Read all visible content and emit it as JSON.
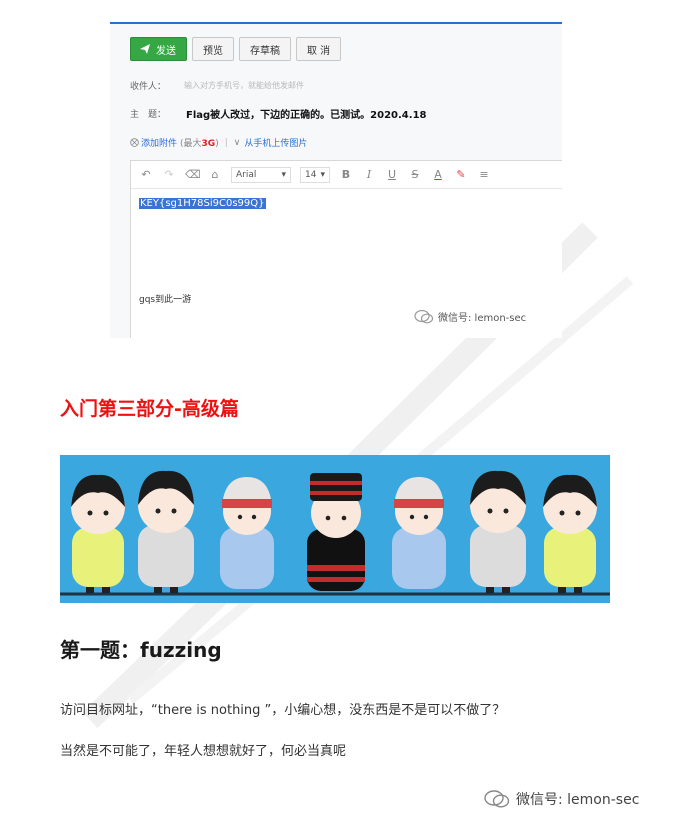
{
  "email": {
    "toolbar": {
      "send": "发送",
      "preview": "预览",
      "draft": "存草稿",
      "cancel": "取 消"
    },
    "recipient_label": "收件人：",
    "recipient_placeholder": "输入对方手机号，就能给他发邮件",
    "subject_label": "主　题：",
    "subject_value": "Flag被人改过，下边的正确的。已测试。2020.4.18",
    "attachment_link": "添加附件",
    "attachment_limit_prefix": "(最大",
    "attachment_limit_value": "3G",
    "attachment_limit_suffix": ")",
    "upload_link": "从手机上传图片",
    "editor": {
      "font": "Arial",
      "size": "14",
      "bold": "B",
      "italic": "I",
      "underline": "U",
      "strike": "S",
      "font_color": "A",
      "key_text": "KEY{sg1H78Si9C0s99Q}",
      "footer_text": "gqs到此一游"
    },
    "inner_watermark": "微信号: lemon-sec"
  },
  "section_title": "入门第三部分-高级篇",
  "question_title": "第一题：fuzzing",
  "paragraph1": "访问目标网址，“there is nothing ”，小编心想，没东西是不是可以不做了？",
  "paragraph2": "当然是不可能了，年轻人想想就好了，何必当真呢",
  "footer_watermark": "微信号: lemon-sec",
  "colors": {
    "accent_red": "#ee1111",
    "send_green": "#35a744",
    "link_blue": "#2a6fd6",
    "banner_blue": "#3aa7de"
  }
}
